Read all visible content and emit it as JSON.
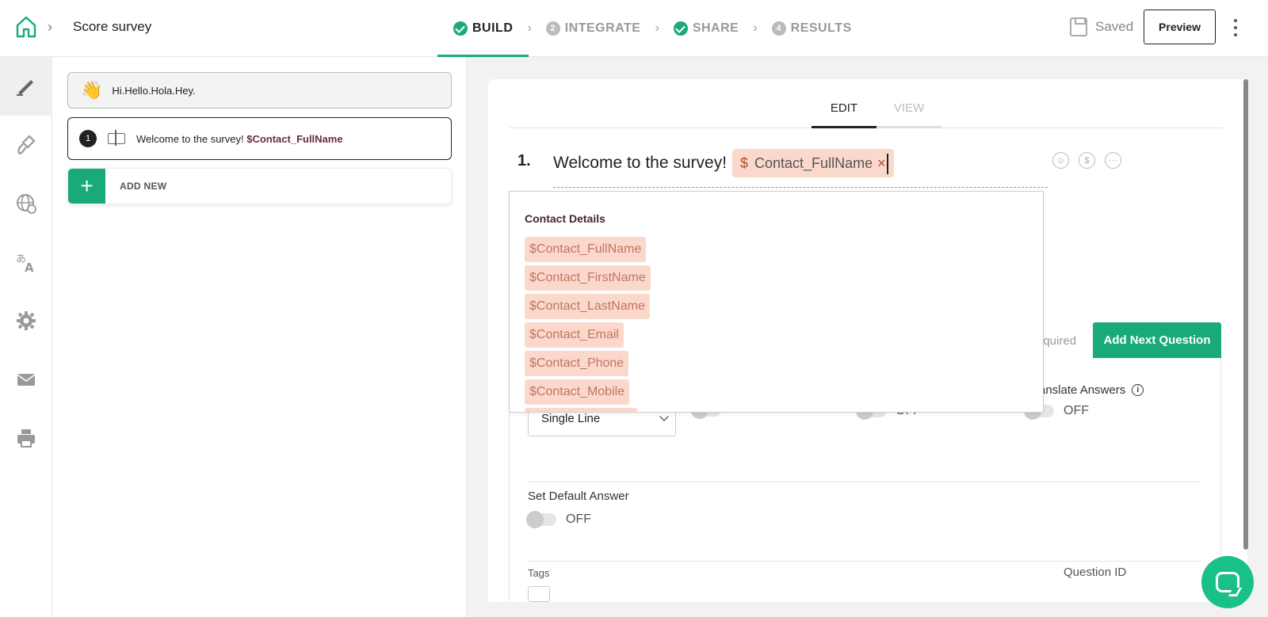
{
  "header": {
    "survey_title": "Score survey",
    "steps": [
      {
        "label": "BUILD",
        "marker": "check",
        "active": true
      },
      {
        "label": "INTEGRATE",
        "marker": "2",
        "active": false
      },
      {
        "label": "SHARE",
        "marker": "check",
        "active": false
      },
      {
        "label": "RESULTS",
        "marker": "4",
        "active": false
      }
    ],
    "saved_label": "Saved",
    "preview_label": "Preview"
  },
  "rail": {
    "items": [
      "pen-icon",
      "paintbrush-icon",
      "globe-icon",
      "translate-icon",
      "gear-icon",
      "mail-icon",
      "printer-icon"
    ]
  },
  "question_list": {
    "welcome_text": "Hi.Hello.Hola.Hey.",
    "q1_number": "1",
    "q1_text": "Welcome to the survey! ",
    "q1_pipe": "$Contact_FullName",
    "add_new_label": "ADD NEW"
  },
  "editor": {
    "tabs": {
      "edit": "EDIT",
      "view": "VIEW"
    },
    "question_number": "1.",
    "question_text": "Welcome to the survey!",
    "chip_symbol": "$",
    "chip_label": "Contact_FullName",
    "chip_remove": "×",
    "required_fragment": "equired",
    "add_next_label": "Add Next Question",
    "translate_label": "ranslate Answers",
    "select_value": "Single Line",
    "toggle_off": "OFF",
    "default_answer_label": "Set Default Answer",
    "tags_label": "Tags",
    "question_id_label": "Question ID"
  },
  "dropdown": {
    "heading": "Contact Details",
    "items": [
      "$Contact_FullName",
      "$Contact_FirstName",
      "$Contact_LastName",
      "$Contact_Email",
      "$Contact_Phone",
      "$Contact_Mobile"
    ]
  },
  "colors": {
    "accent": "#1aaa78",
    "chip_bg": "#fbd8cc",
    "chip_text": "#c0765f"
  }
}
